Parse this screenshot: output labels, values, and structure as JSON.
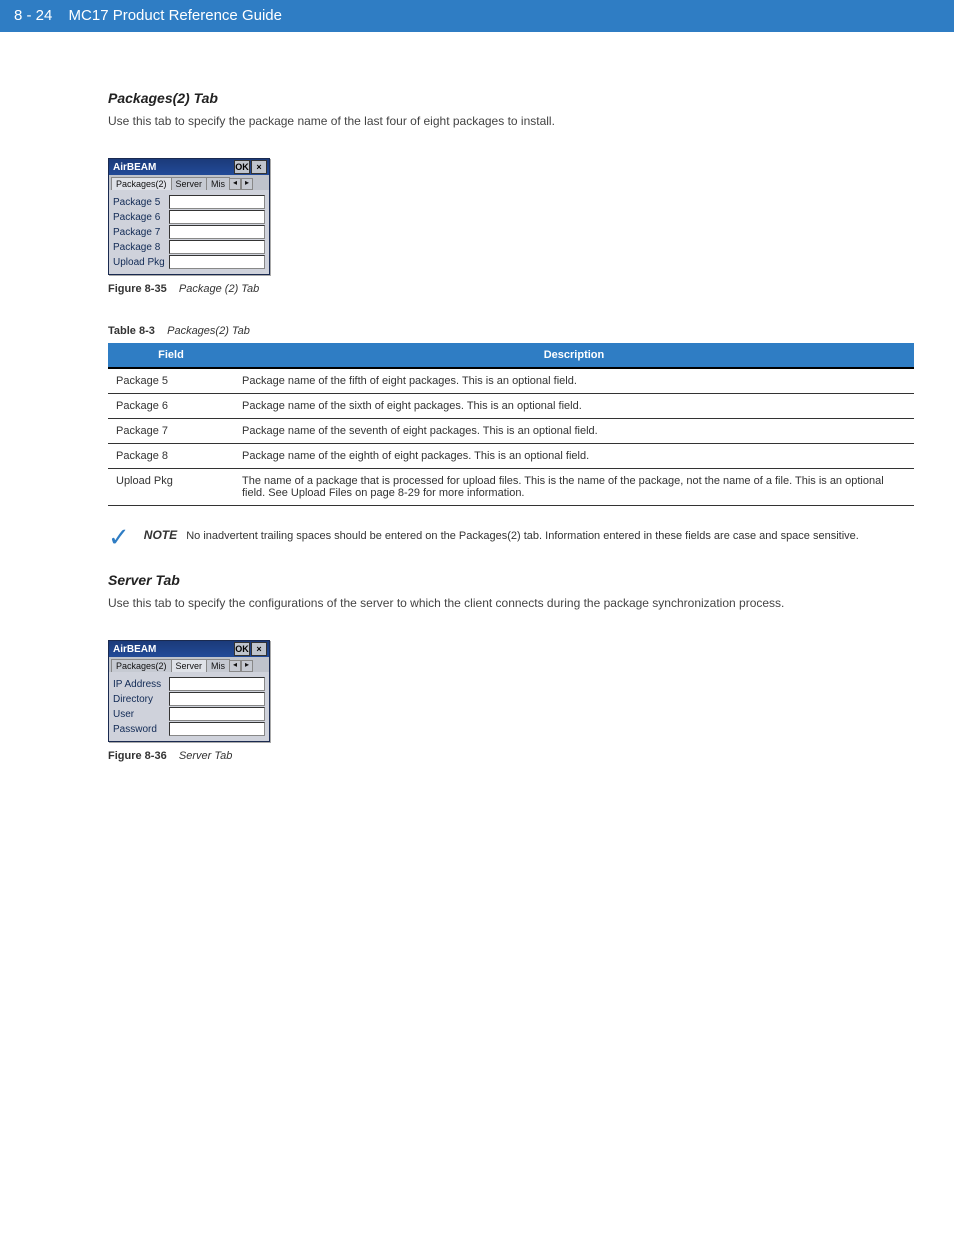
{
  "header": {
    "page_number": "8 - 24",
    "doc_title": "MC17 Product Reference Guide"
  },
  "sections": {
    "packages2": {
      "title": "Packages(2) Tab",
      "desc": "Use this tab to specify the package name of the last four of eight packages to install.",
      "figure": {
        "num": "Figure 8-35",
        "caption": "Package (2) Tab",
        "win_title": "AirBEAM",
        "ok": "OK",
        "close": "×",
        "tabs": [
          "Packages(2)",
          "Server",
          "Mis"
        ],
        "active_tab": 0,
        "rows": [
          "Package 5",
          "Package 6",
          "Package 7",
          "Package 8",
          "Upload Pkg"
        ]
      }
    },
    "server": {
      "title": "Server Tab",
      "desc": "Use this tab to specify the configurations of the server to which the client connects during the package synchronization process.",
      "figure": {
        "num": "Figure 8-36",
        "caption": "Server Tab",
        "win_title": "AirBEAM",
        "ok": "OK",
        "close": "×",
        "tabs": [
          "Packages(2)",
          "Server",
          "Mis"
        ],
        "active_tab": 1,
        "rows": [
          "IP Address",
          "Directory",
          "User",
          "Password"
        ]
      }
    }
  },
  "table": {
    "num": "Table 8-3",
    "caption": "Packages(2) Tab",
    "head_field": "Field",
    "head_desc": "Description",
    "rows": [
      {
        "field": "Package 5",
        "desc": "Package name of the fifth of eight packages. This is an optional field."
      },
      {
        "field": "Package 6",
        "desc": "Package name of the sixth of eight packages. This is an optional field."
      },
      {
        "field": "Package 7",
        "desc": "Package name of the seventh of eight packages. This is an optional field."
      },
      {
        "field": "Package 8",
        "desc": "Package name of the eighth of eight packages. This is an optional field."
      },
      {
        "field": "Upload Pkg",
        "desc": "The name of a package that is processed for upload files. This is the name of the package, not the name of a file. This is an optional field. See Upload Files on page 8-29 for more information."
      }
    ]
  },
  "note": {
    "label": "NOTE",
    "text": "No inadvertent trailing spaces should be entered on the Packages(2) tab. Information entered in these fields are case and space sensitive."
  }
}
